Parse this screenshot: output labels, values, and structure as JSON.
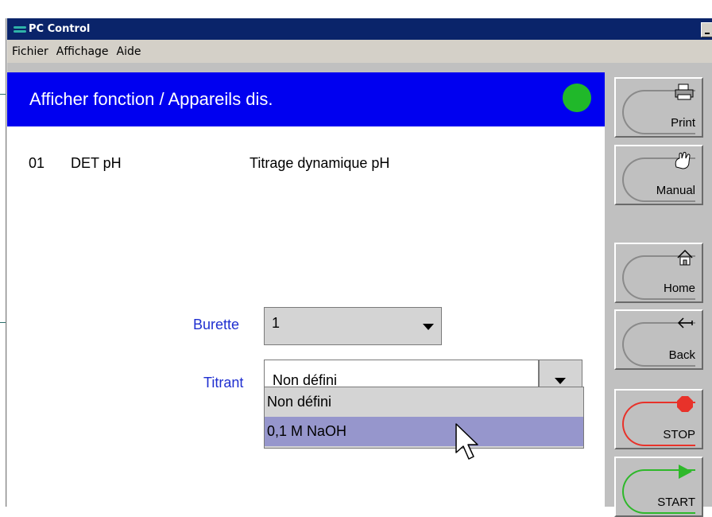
{
  "window": {
    "title": "PC Control"
  },
  "menu": {
    "items": [
      "Fichier",
      "Affichage",
      "Aide"
    ]
  },
  "header": {
    "title": "Afficher fonction / Appareils dis.",
    "status_color": "#20b82a"
  },
  "method": {
    "number": "01",
    "name": "DET pH",
    "description": "Titrage dynamique pH"
  },
  "form": {
    "burette_label": "Burette",
    "burette_value": "1",
    "titrant_label": "Titrant",
    "titrant_value": "Non défini",
    "titrant_options": [
      "Non défini",
      "0,1 M NaOH"
    ],
    "highlighted_option": "0,1 M NaOH"
  },
  "side_buttons": {
    "print": {
      "label": "Print",
      "icon": "printer-icon"
    },
    "manual": {
      "label": "Manual",
      "icon": "hand-icon"
    },
    "home": {
      "label": "Home",
      "icon": "house-icon"
    },
    "back": {
      "label": "Back",
      "icon": "back-arrow-icon"
    },
    "stop": {
      "label": "STOP",
      "icon": "stop-dot-icon",
      "color": "#e8322a"
    },
    "start": {
      "label": "START",
      "icon": "play-triangle-icon",
      "color": "#2eb82a"
    }
  },
  "colors": {
    "header_bg": "#0000f0",
    "label_blue": "#1f2fd0",
    "titlebar_bg": "#0a246a",
    "selection_bg": "#9696cc"
  }
}
